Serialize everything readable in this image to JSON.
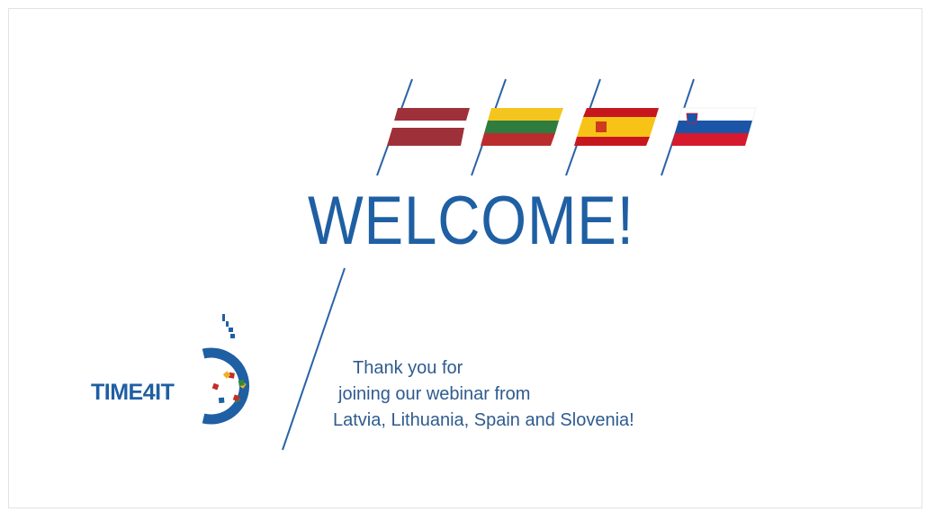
{
  "slide": {
    "heading": "WELCOME!",
    "message_lines": [
      "Thank you for",
      "joining our webinar from",
      "Latvia, Lithuania, Spain and Slovenia!"
    ]
  },
  "logo": {
    "text": "TIME4IT"
  },
  "flags": [
    "latvia",
    "lithuania",
    "spain",
    "slovenia"
  ],
  "colors": {
    "brand_blue": "#1f5fa3",
    "text_blue": "#2f5b8f"
  }
}
